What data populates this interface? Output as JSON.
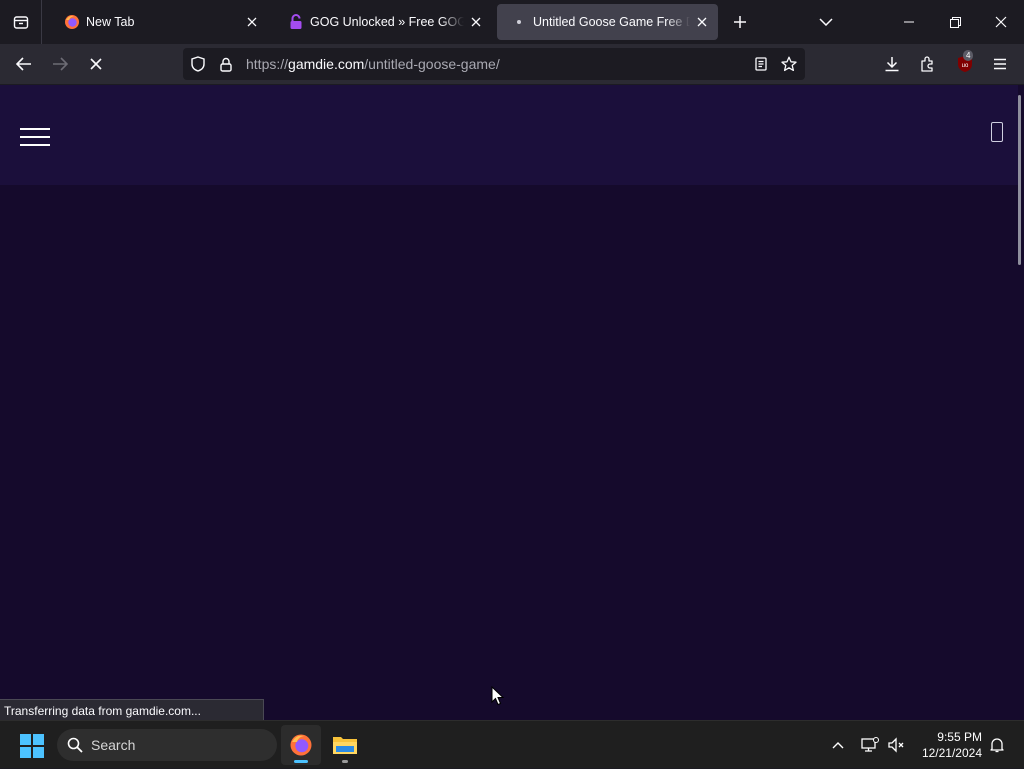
{
  "browser": {
    "tabs": [
      {
        "title": "New Tab",
        "favicon": "firefox-icon",
        "active": false
      },
      {
        "title": "GOG Unlocked » Free GOG Games",
        "favicon": "gog-unlocked-icon",
        "active": false
      },
      {
        "title": "Untitled Goose Game Free Download",
        "favicon": "loading-dot-icon",
        "active": true
      }
    ],
    "url": {
      "scheme": "https://",
      "host": "gamdie.com",
      "path": "/untitled-goose-game/"
    },
    "extension_badge": "4",
    "status_text": "Transferring data from gamdie.com..."
  },
  "taskbar": {
    "search_placeholder": "Search",
    "time": "9:55 PM",
    "date": "12/21/2024"
  },
  "colors": {
    "page_bg": "#150a2c",
    "site_header_bg": "#1b0f3b",
    "accent": "#4cc2ff"
  }
}
